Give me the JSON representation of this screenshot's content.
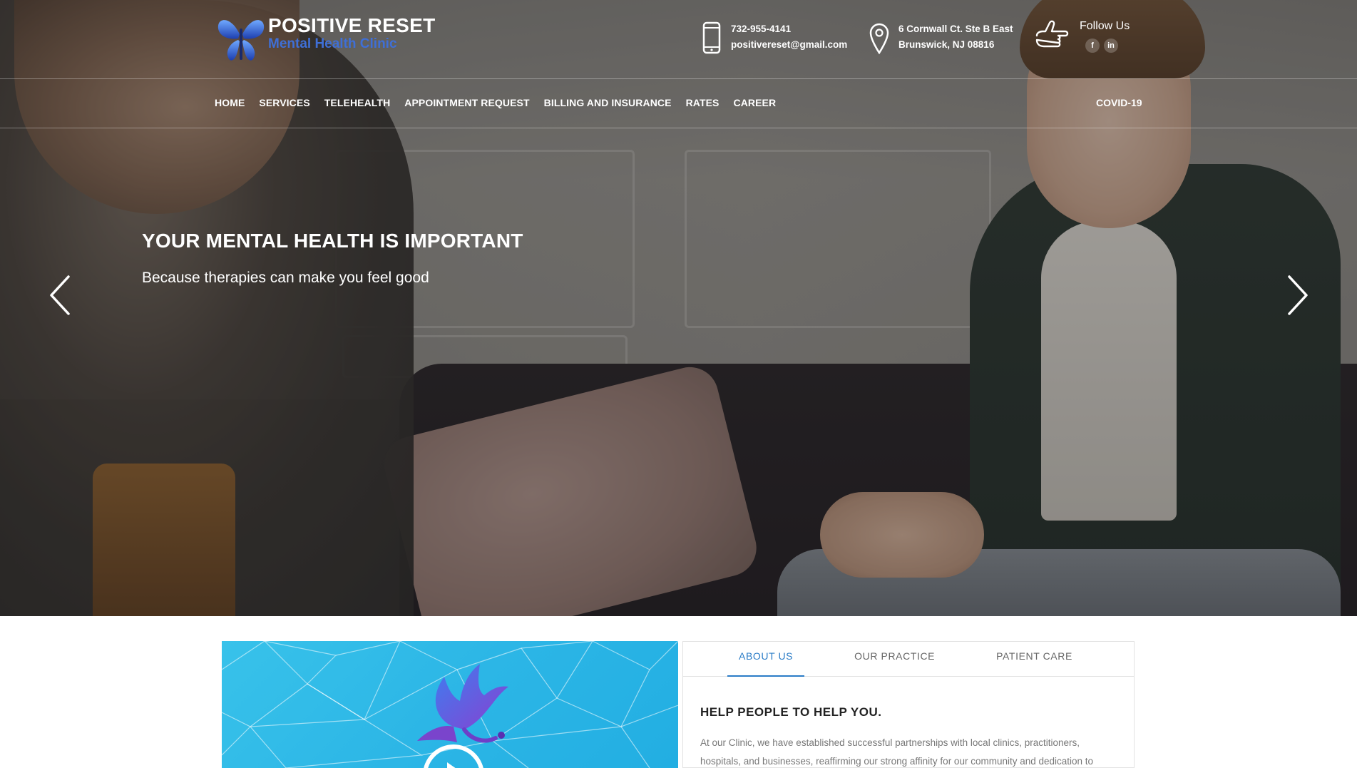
{
  "brand": {
    "title": "POSITIVE RESET",
    "subtitle": "Mental Health Clinic"
  },
  "contact": {
    "phone": "732-955-4141",
    "email": "positivereset@gmail.com",
    "address_line1": "6 Cornwall Ct. Ste B East",
    "address_line2": "Brunswick, NJ 08816",
    "follow_label": "Follow Us",
    "socials": [
      {
        "icon": "facebook-icon",
        "label": "f"
      },
      {
        "icon": "linkedin-icon",
        "label": "in"
      }
    ]
  },
  "nav": {
    "items": [
      "HOME",
      "SERVICES",
      "TELEHEALTH",
      "APPOINTMENT REQUEST",
      "BILLING AND INSURANCE",
      "RATES",
      "CAREER"
    ],
    "right_item": "COVID-19"
  },
  "hero": {
    "title": "YOUR MENTAL HEALTH IS IMPORTANT",
    "subtitle": "Because therapies can make you feel good"
  },
  "tabs": {
    "items": [
      "ABOUT US",
      "OUR PRACTICE",
      "PATIENT CARE"
    ],
    "active": "ABOUT US",
    "heading": "HELP PEOPLE TO HELP YOU.",
    "body": "At our Clinic, we have established successful partnerships with local clinics, practitioners, hospitals, and businesses, reaffirming our strong affinity for our community and dedication to"
  },
  "colors": {
    "accent": "#2a7cc7",
    "brand_blue": "#3f6fd6",
    "video_bg": "#2cb6e6"
  }
}
